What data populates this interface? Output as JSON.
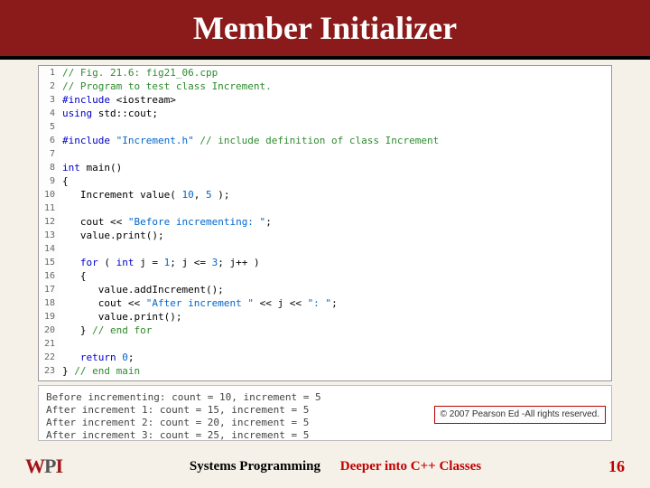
{
  "title": "Member Initializer",
  "code": [
    {
      "n": "1",
      "cls": "c-comment",
      "t": "// Fig. 21.6: fig21_06.cpp"
    },
    {
      "n": "2",
      "cls": "c-comment",
      "t": "// Program to test class Increment."
    },
    {
      "n": "3",
      "cls": "mix",
      "html": "<span class='c-keyword'>#include</span> <span class='c-plain'>&lt;iostream&gt;</span>"
    },
    {
      "n": "4",
      "cls": "mix",
      "html": "<span class='c-keyword'>using</span> <span class='c-plain'>std::cout;</span>"
    },
    {
      "n": "5",
      "cls": "c-plain",
      "t": ""
    },
    {
      "n": "6",
      "cls": "mix",
      "html": "<span class='c-keyword'>#include</span> <span class='c-string'>\"Increment.h\"</span> <span class='c-comment'>// include definition of class Increment</span>"
    },
    {
      "n": "7",
      "cls": "c-plain",
      "t": ""
    },
    {
      "n": "8",
      "cls": "mix",
      "html": "<span class='c-type'>int</span> <span class='c-plain'>main()</span>"
    },
    {
      "n": "9",
      "cls": "c-plain",
      "t": "{"
    },
    {
      "n": "10",
      "cls": "mix",
      "html": "   <span class='c-plain'>Increment value(</span> <span class='c-num'>10</span><span class='c-plain'>,</span> <span class='c-num'>5</span> <span class='c-plain'>);</span>"
    },
    {
      "n": "11",
      "cls": "c-plain",
      "t": ""
    },
    {
      "n": "12",
      "cls": "mix",
      "html": "   <span class='c-plain'>cout &lt;&lt;</span> <span class='c-string'>\"Before incrementing: \"</span><span class='c-plain'>;</span>"
    },
    {
      "n": "13",
      "cls": "c-plain",
      "t": "   value.print();"
    },
    {
      "n": "14",
      "cls": "c-plain",
      "t": ""
    },
    {
      "n": "15",
      "cls": "mix",
      "html": "   <span class='c-keyword'>for</span> <span class='c-plain'>(</span> <span class='c-type'>int</span> <span class='c-plain'>j =</span> <span class='c-num'>1</span><span class='c-plain'>; j &lt;=</span> <span class='c-num'>3</span><span class='c-plain'>; j++ )</span>"
    },
    {
      "n": "16",
      "cls": "c-plain",
      "t": "   {"
    },
    {
      "n": "17",
      "cls": "c-plain",
      "t": "      value.addIncrement();"
    },
    {
      "n": "18",
      "cls": "mix",
      "html": "      <span class='c-plain'>cout &lt;&lt;</span> <span class='c-string'>\"After increment \"</span> <span class='c-plain'>&lt;&lt; j &lt;&lt;</span> <span class='c-string'>\": \"</span><span class='c-plain'>;</span>"
    },
    {
      "n": "19",
      "cls": "c-plain",
      "t": "      value.print();"
    },
    {
      "n": "20",
      "cls": "mix",
      "html": "   <span class='c-plain'>}</span> <span class='c-comment'>// end for</span>"
    },
    {
      "n": "21",
      "cls": "c-plain",
      "t": ""
    },
    {
      "n": "22",
      "cls": "mix",
      "html": "   <span class='c-keyword'>return</span> <span class='c-num'>0</span><span class='c-plain'>;</span>"
    },
    {
      "n": "23",
      "cls": "mix",
      "html": "<span class='c-plain'>}</span> <span class='c-comment'>// end main</span>"
    }
  ],
  "output": [
    "Before incrementing: count = 10, increment = 5",
    "After increment 1: count = 15, increment = 5",
    "After increment 2: count = 20, increment = 5",
    "After increment 3: count = 25, increment = 5"
  ],
  "copyright": "© 2007 Pearson Ed -All rights reserved.",
  "footer": {
    "logo_w": "W",
    "logo_p": "P",
    "logo_i": "I",
    "left": "Systems Programming",
    "right": "Deeper into C++ Classes",
    "page": "16"
  }
}
